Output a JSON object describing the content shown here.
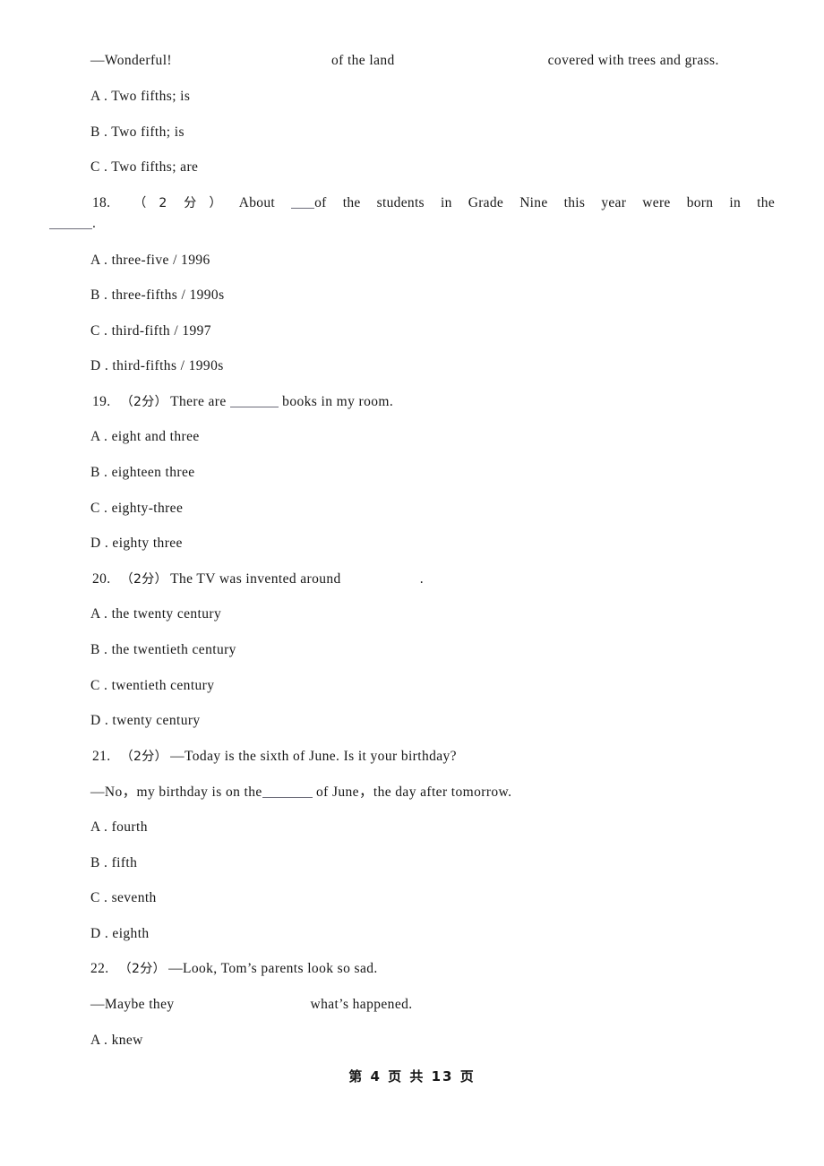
{
  "document": {
    "type": "exam-paper",
    "language": "en-zh",
    "page_number": 4,
    "total_pages": 13,
    "footer_text": "第 4 页 共 13 页"
  },
  "continued_question": {
    "stem_line": "—Wonderful!",
    "stem_mid": "of the land",
    "stem_tail": "covered with trees and grass.",
    "options": [
      "A . Two fifths; is",
      "B . Two fifth; is",
      "C . Two fifths; are"
    ]
  },
  "questions": [
    {
      "number": "18.",
      "score": "（2 分）",
      "stem_part1": "About ",
      "stem_blank": "____",
      "stem_part2": "of the students in Grade Nine this year were born in the",
      "stem_wrap_blank": "______",
      "stem_wrap_tail": ".",
      "options": [
        "A . three-five / 1996",
        "B . three-fifths / 1990s",
        "C . third-fifth / 1997",
        "D . third-fifths / 1990s"
      ]
    },
    {
      "number": "19.",
      "score": "（2分）",
      "stem_part1": "There are ",
      "stem_part2": " books in my room.",
      "options": [
        "A . eight and three",
        "B . eighteen three",
        "C . eighty-three",
        "D . eighty three"
      ]
    },
    {
      "number": "20.",
      "score": "（2分）",
      "stem_part1": "The TV was invented around",
      "stem_part2": ".",
      "options": [
        "A . the twenty century",
        "B . the twentieth century",
        "C . twentieth century",
        "D . twenty century"
      ]
    },
    {
      "number": "21.",
      "score": "（2分）",
      "stem_part1": "—Today is the sixth of June. Is it your birthday?",
      "stem_line2_a": "—No，my birthday is on the",
      "stem_line2_b": " of June，the day after tomorrow.",
      "options": [
        "A . fourth",
        "B . fifth",
        "C . seventh",
        "D . eighth"
      ]
    },
    {
      "number": "22.",
      "score": "（2分）",
      "stem_part1": "—Look, Tom’s parents look so sad.",
      "stem_line2_a": "—Maybe they",
      "stem_line2_b": "what’s happened.",
      "options": [
        "A . knew"
      ]
    }
  ]
}
